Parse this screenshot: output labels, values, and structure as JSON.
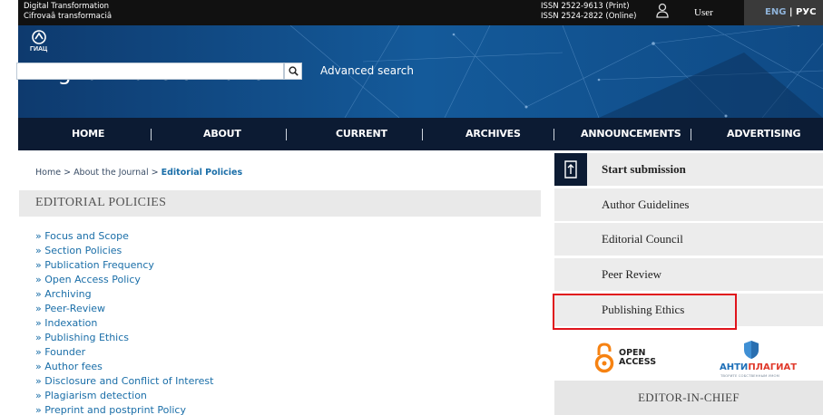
{
  "header": {
    "journal_name_en": "Digital Transformation",
    "journal_name_translit": "Cifrovaâ transformaciâ",
    "issn_print": "ISSN 2522-9613 (Print)",
    "issn_online": "ISSN 2524-2822 (Online)",
    "user_label": "User",
    "lang_en": "ENG",
    "lang_sep": " | ",
    "lang_ru": "РУС"
  },
  "banner": {
    "logo_text": "ГИАЦ",
    "site_title": "Digital Transformation",
    "search_placeholder": "",
    "advanced_search": "Advanced search"
  },
  "nav": {
    "items": [
      "HOME",
      "ABOUT",
      "CURRENT",
      "ARCHIVES",
      "ANNOUNCEMENTS",
      "ADVERTISING"
    ]
  },
  "breadcrumb": {
    "home": "Home",
    "sep": " > ",
    "about": "About the Journal",
    "current": "Editorial Policies"
  },
  "page": {
    "section_title": "EDITORIAL POLICIES",
    "policies": [
      "» Focus and Scope",
      "» Section Policies",
      "» Publication Frequency",
      "» Open Access Policy",
      "» Archiving",
      "» Peer-Review",
      "» Indexation",
      "» Publishing Ethics",
      "» Founder",
      "» Author fees",
      "» Disclosure and Conflict of Interest",
      "» Plagiarism detection",
      "» Preprint and postprint Policy"
    ]
  },
  "sidebar": {
    "start_submission": "Start submission",
    "items": [
      "Author Guidelines",
      "Editorial Council",
      "Peer Review",
      "Publishing Ethics"
    ],
    "open_access_line1": "OPEN",
    "open_access_line2": "ACCESS",
    "antiplagiat_part1": "АНТИ",
    "antiplagiat_part2": "ПЛАГИАТ",
    "antiplagiat_sub": "ТВОРИТЕ СОБСТВЕННЫМ УМОМ",
    "editor_heading": "EDITOR-IN-CHIEF"
  },
  "colors": {
    "banner": "#0f3f73",
    "nav": "#0c1b33",
    "link": "#1a6ea8",
    "highlight": "#e0141c",
    "open_access": "#f68212"
  }
}
